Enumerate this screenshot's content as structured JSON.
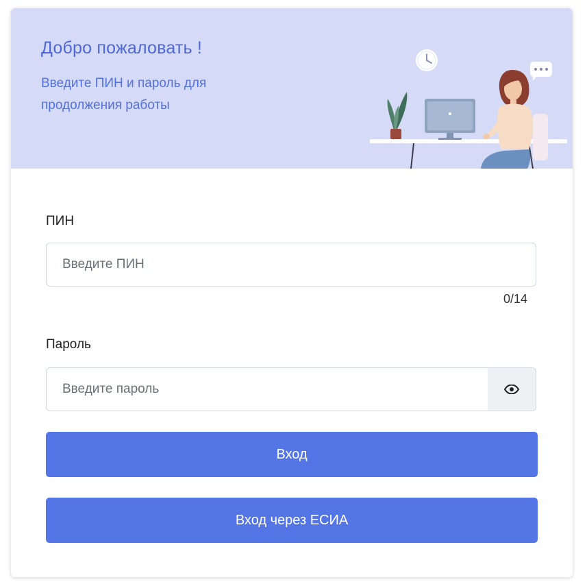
{
  "header": {
    "title": "Добро пожаловать !",
    "subtitle": "Введите ПИН и пароль для продолжения работы"
  },
  "form": {
    "pin": {
      "label": "ПИН",
      "placeholder": "Введите ПИН",
      "value": "",
      "counter": "0/14"
    },
    "password": {
      "label": "Пароль",
      "placeholder": "Введите пароль",
      "value": "",
      "toggle_icon": "eye-icon"
    },
    "login_button": "Вход",
    "esia_button": "Вход через ЕСИА"
  },
  "colors": {
    "header_bg": "#d5dbf7",
    "accent": "#5475e6",
    "header_text": "#4f67d9"
  }
}
